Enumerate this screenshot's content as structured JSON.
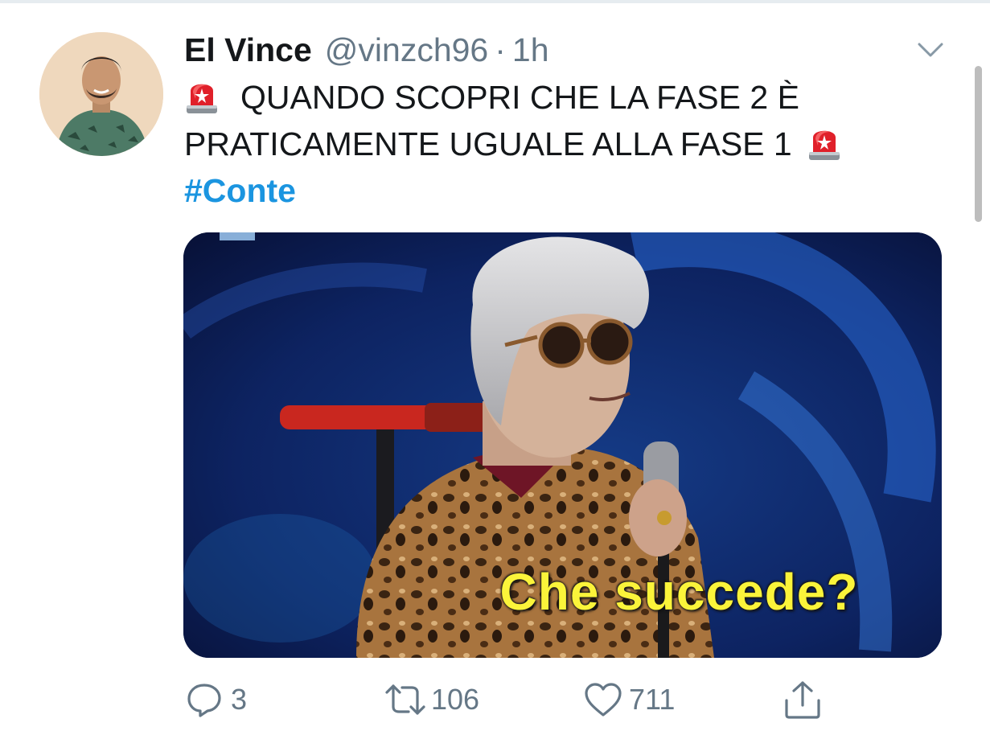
{
  "tweet": {
    "author_name": "El Vince",
    "handle": "@vinzch96",
    "separator": "·",
    "time": "1h",
    "text_line1": "QUANDO SCOPRI CHE LA FASE 2 È",
    "text_line2": "PRATICAMENTE UGUALE ALLA FASE 1",
    "hashtag": "#Conte",
    "emoji_icon": "police-car-light-emoji",
    "media": {
      "caption": "Che succede?",
      "caption_color": "#fbf43a"
    }
  },
  "actions": {
    "reply_count": "3",
    "retweet_count": "106",
    "like_count": "711"
  },
  "colors": {
    "text": "#14171a",
    "secondary": "#657786",
    "link": "#1b95e0"
  }
}
